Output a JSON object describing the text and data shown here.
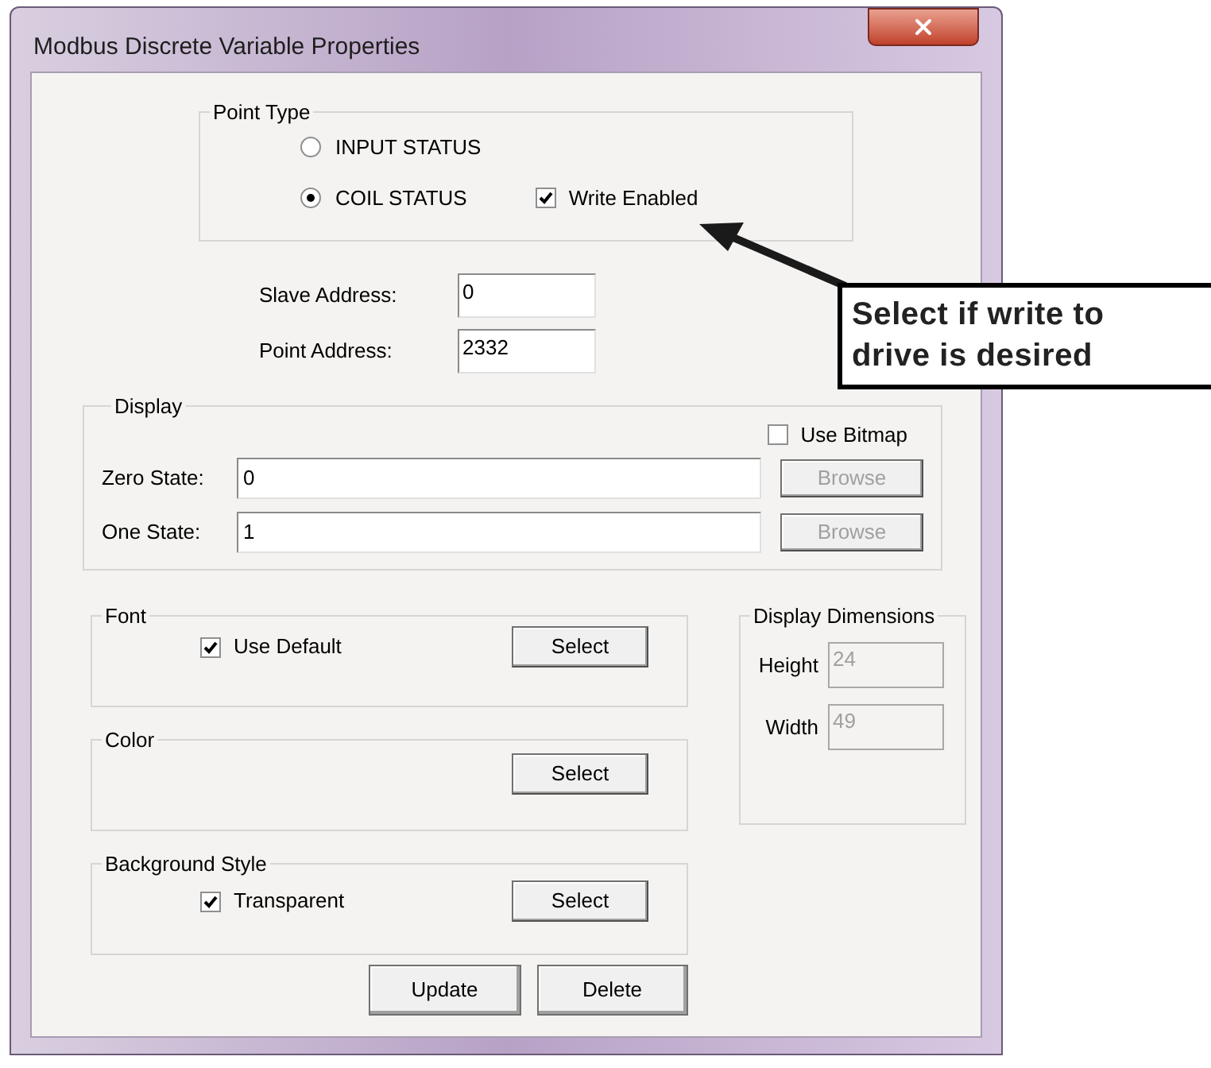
{
  "window": {
    "title": "Modbus Discrete Variable Properties"
  },
  "point_type": {
    "title": "Point Type",
    "options": [
      {
        "label": "INPUT STATUS",
        "selected": false
      },
      {
        "label": "COIL STATUS",
        "selected": true
      }
    ],
    "write_enabled": {
      "label": "Write Enabled",
      "checked": true
    }
  },
  "addresses": [
    {
      "label": "Slave Address:",
      "value": "0"
    },
    {
      "label": "Point Address:",
      "value": "2332"
    }
  ],
  "display": {
    "title": "Display",
    "use_bitmap": {
      "label": "Use Bitmap",
      "checked": false
    },
    "states": [
      {
        "label": "Zero State:",
        "value": "0",
        "browse": "Browse",
        "disabled": true
      },
      {
        "label": "One State:",
        "value": "1",
        "browse": "Browse",
        "disabled": true
      }
    ]
  },
  "font": {
    "title": "Font",
    "use_default": {
      "label": "Use Default",
      "checked": true
    },
    "button": "Select"
  },
  "color": {
    "title": "Color",
    "button": "Select"
  },
  "background_style": {
    "title": "Background Style",
    "transparent": {
      "label": "Transparent",
      "checked": true
    },
    "button": "Select"
  },
  "display_dimensions": {
    "title": "Display Dimensions",
    "fields": [
      {
        "label": "Height",
        "value": "24",
        "disabled": true
      },
      {
        "label": "Width",
        "value": "49",
        "disabled": true
      }
    ]
  },
  "buttons": [
    "Update",
    "Delete"
  ],
  "callout": {
    "text": "Select if write to drive is desired"
  }
}
